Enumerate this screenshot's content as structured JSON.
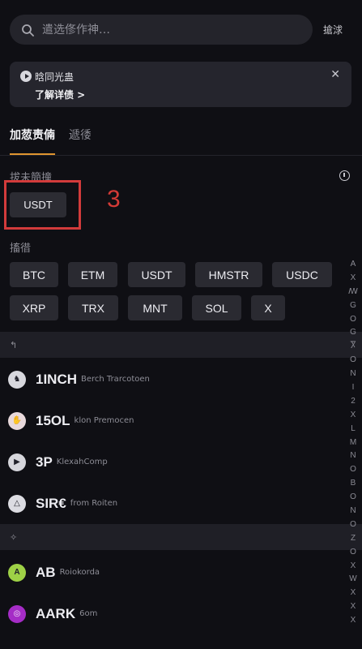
{
  "search": {
    "placeholder": "遣选俢作神…",
    "cancel_label": "搶浗"
  },
  "notice": {
    "title": "晗同光蛊",
    "link_label": "了解详债 >"
  },
  "tabs": [
    {
      "label": "加䓤责㑲",
      "active": true
    },
    {
      "label": "遞㣦",
      "active": false
    }
  ],
  "recent": {
    "title": "拔未簡撞",
    "chips": [
      "USDT"
    ]
  },
  "annotation": {
    "step": "3",
    "color": "#d23b3b"
  },
  "hot": {
    "title": "搐徣",
    "chips": [
      "BTC",
      "ETM",
      "USDT",
      "HMSTR",
      "USDC",
      "XRP",
      "TRX",
      "MNT",
      "SOL",
      "X"
    ]
  },
  "sections": [
    {
      "header": "↰",
      "tokens": [
        {
          "symbol": "1INCH",
          "name": "Berch Trarcotoen",
          "icon": "horse-icon",
          "color": "#d8d8de"
        },
        {
          "symbol": "15OL",
          "name": "klon Premocen",
          "icon": "hand-icon",
          "color": "#e8d9dc"
        },
        {
          "symbol": "3P",
          "name": "KlexahComp",
          "icon": "play-icon",
          "color": "#d6d6dc"
        },
        {
          "symbol": "SIR€",
          "name": "from Roiten",
          "icon": "triangle-icon",
          "color": "#dcdce2"
        }
      ]
    },
    {
      "header": "✧",
      "tokens": [
        {
          "symbol": "AB",
          "name": "Roiokorda",
          "icon": "ab-icon",
          "color": "#9ed146"
        },
        {
          "symbol": "AARK",
          "name": "6om",
          "icon": "ring-icon",
          "color": "#a52cc6"
        }
      ]
    }
  ],
  "index": [
    "A",
    "X",
    "ꟿ",
    "G",
    "O",
    "G",
    "Ⴟ",
    "O",
    "N",
    "I",
    "2",
    "X",
    "L",
    "M",
    "N",
    "O",
    "B",
    "O",
    "N",
    "O",
    "Z",
    "O",
    "X",
    "W",
    "X",
    "X",
    "X"
  ],
  "colors": {
    "accent": "#e0952f",
    "background": "#0f0f14"
  }
}
